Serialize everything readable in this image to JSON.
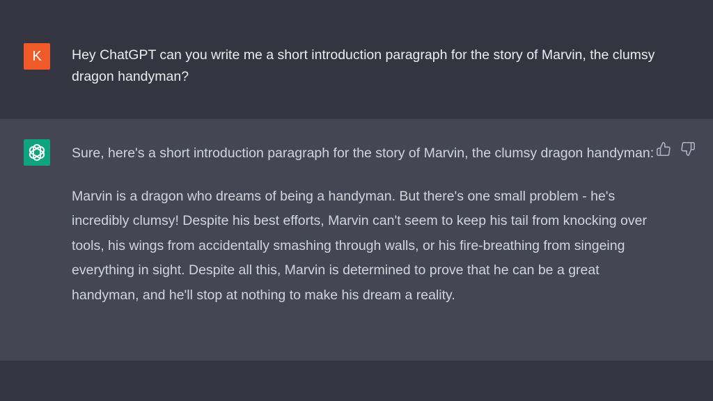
{
  "user_message": {
    "avatar_letter": "K",
    "text": "Hey ChatGPT can you write me a short introduction paragraph for the story of Marvin, the clumsy dragon handyman?"
  },
  "assistant_message": {
    "paragraphs": [
      "Sure, here's a short introduction paragraph for the story of Marvin, the clumsy dragon handyman:",
      "Marvin is a dragon who dreams of being a handyman. But there's one small problem - he's incredibly clumsy! Despite his best efforts, Marvin can't seem to keep his tail from knocking over tools, his wings from accidentally smashing through walls, or his fire-breathing from singeing everything in sight. Despite all this, Marvin is determined to prove that he can be a great handyman, and he'll stop at nothing to make his dream a reality."
    ]
  },
  "icons": {
    "assistant_avatar": "openai-logo-icon",
    "like": "thumbs-up-icon",
    "dislike": "thumbs-down-icon"
  },
  "colors": {
    "background": "#343541",
    "assistant_background": "#444654",
    "user_avatar": "#f05a28",
    "assistant_avatar": "#10a37f",
    "text": "#d1d5db"
  }
}
